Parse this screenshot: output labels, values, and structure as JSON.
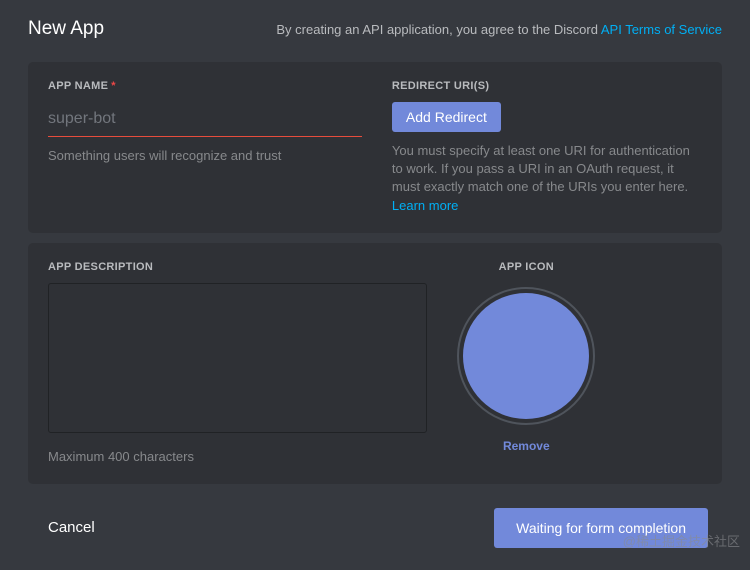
{
  "header": {
    "title": "New App",
    "agreement_prefix": "By creating an API application, you agree to the Discord ",
    "tos_link": "API Terms of Service"
  },
  "app_name": {
    "label": "APP NAME",
    "required_star": "*",
    "placeholder": "super-bot",
    "value": "",
    "helper": "Something users will recognize and trust"
  },
  "redirect": {
    "label": "REDIRECT URI(S)",
    "add_button": "Add Redirect",
    "helper_text": "You must specify at least one URI for authentication to work. If you pass a URI in an OAuth request, it must exactly match one of the URIs you enter here. ",
    "learn_more": "Learn more"
  },
  "description": {
    "label": "APP DESCRIPTION",
    "value": "",
    "helper": "Maximum 400 characters"
  },
  "icon": {
    "label": "APP ICON",
    "remove": "Remove"
  },
  "footer": {
    "cancel": "Cancel",
    "submit": "Waiting for form completion"
  },
  "watermark": "@稀土掘金技术社区",
  "colors": {
    "accent": "#7289da",
    "link": "#00aff4",
    "panel": "#2f3136",
    "bg": "#36393f",
    "error": "#e74c3c"
  }
}
